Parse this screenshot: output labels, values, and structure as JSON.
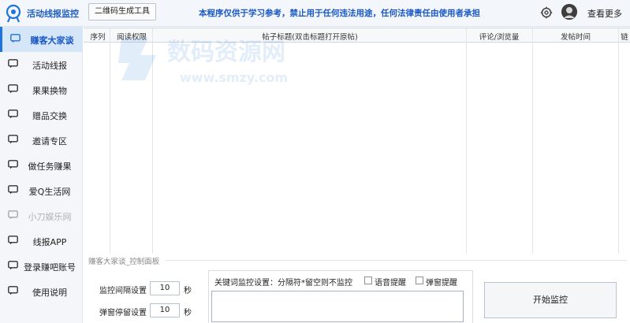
{
  "header": {
    "app_title": "活动线报监控",
    "qr_button": "二维码生成工具",
    "notice": "本程序仅供于学习参考，禁止用于任何违法用途，任何法律责任由使用者承担",
    "more_label": "查看更多",
    "accent_color": "#1a58c6"
  },
  "sidebar": {
    "items": [
      {
        "label": "赚客大家谈",
        "active": true
      },
      {
        "label": "活动线报"
      },
      {
        "label": "果果换物"
      },
      {
        "label": "赠品交换"
      },
      {
        "label": "邀请专区"
      },
      {
        "label": "做任务赚果"
      },
      {
        "label": "爱Q生活网"
      },
      {
        "label": "小刀娱乐网",
        "disabled": true
      },
      {
        "label": "线报APP"
      },
      {
        "label": "登录赚吧账号"
      },
      {
        "label": "使用说明"
      }
    ]
  },
  "table": {
    "columns": [
      "序列",
      "阅读权限",
      "帖子标题(双击标题打开原帖)",
      "评论/浏览量",
      "发帖时间",
      "链"
    ]
  },
  "watermark": {
    "line1": "数码资源网",
    "line2": "www.smzy.com"
  },
  "control_panel": {
    "title": "赚客大家谈_控制面板",
    "interval_label": "监控间隔设置",
    "interval_value": "10",
    "interval_unit": "秒",
    "popup_label": "弹窗停留设置",
    "popup_value": "10",
    "popup_unit": "秒",
    "keyword_label": "关键词监控设置：分隔符*留空则不监控",
    "voice_alert": "语音提醒",
    "popup_alert": "弹窗提醒",
    "start_button": "开始监控"
  }
}
